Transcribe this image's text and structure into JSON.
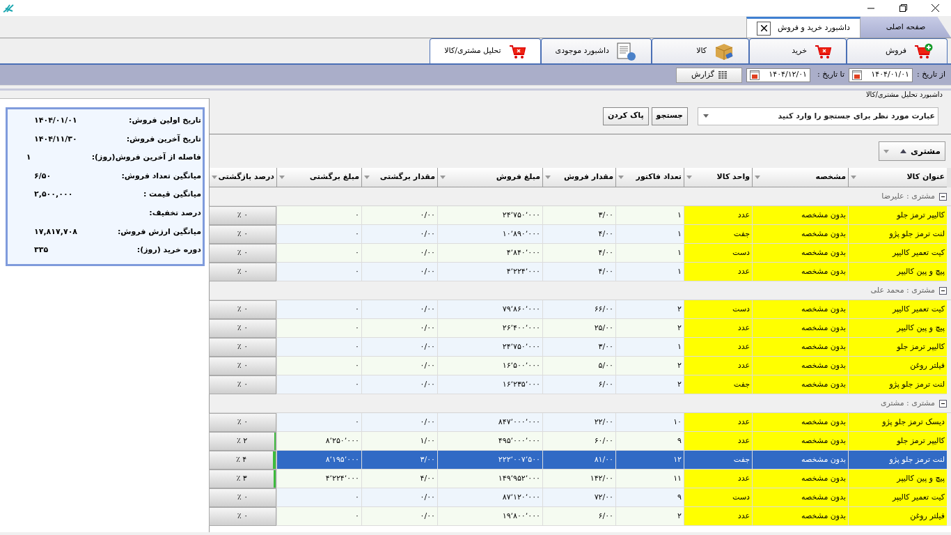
{
  "document_tabs": [
    {
      "label": "صفحه اصلی",
      "selected": false
    },
    {
      "label": "داشبورد خرید و فروش",
      "selected": true
    }
  ],
  "ribbon_tabs": [
    {
      "label": "فروش",
      "kind": "cart-plus",
      "selected": false
    },
    {
      "label": "خرید",
      "kind": "cart-x",
      "selected": false
    },
    {
      "label": "کالا",
      "kind": "box",
      "selected": false
    },
    {
      "label": "داشبورد موجودی",
      "kind": "report",
      "selected": false
    },
    {
      "label": "تحلیل مشتری/کالا",
      "kind": "cart-x",
      "selected": true
    }
  ],
  "toolbar": {
    "from_label": "از تاریخ :",
    "from_value": "۱۴۰۴/۰۱/۰۱",
    "to_label": "تا تاریخ :",
    "to_value": "۱۴۰۴/۱۲/۰۱",
    "report_button": "گزارش"
  },
  "section_title": "داشبورد تحلیل مشتری/کالا",
  "summary": [
    {
      "label": "تاریخ اولین فروش:",
      "value": "۱۴۰۴/۰۱/۰۱"
    },
    {
      "label": "تاریخ آخرین فروش:",
      "value": "۱۴۰۴/۱۱/۳۰"
    },
    {
      "label": "فاصله از آخرین فروش(روز):",
      "value": "۱"
    },
    {
      "label": "میانگین تعداد فروش:",
      "value": "۶/۵۰"
    },
    {
      "label": "میانگین قیمت :",
      "value": "۲,۵۰۰,۰۰۰"
    },
    {
      "label": "درصد تخفیف:"
    },
    {
      "label": "میانگین ارزش فروش:",
      "value": "۱۷,۸۱۷,۷۰۸"
    },
    {
      "label": "دوره خرید (روز):",
      "value": "۳۳۵"
    }
  ],
  "search": {
    "placeholder": "عبارت مورد نظر برای جستجو را وارد کنید",
    "search_button": "جستجو",
    "clear_button": "پاک کردن"
  },
  "group_by": {
    "label": "مشتری",
    "sort_ascending": true
  },
  "table": {
    "columns": [
      "عنوان کالا",
      "مشخصه",
      "واحد کالا",
      "تعداد فاکتور",
      "مقدار فروش",
      "مبلغ فروش",
      "مقدار برگشتی",
      "مبلغ برگشتی",
      "درصد بازگشتی"
    ],
    "groups": [
      {
        "label": "مشتری : علیرضا",
        "expanded": true,
        "rows": [
          {
            "cells": [
              "کالیپر ترمز جلو",
              "بدون مشخصه",
              "عدد",
              "۱",
              "۳/۰۰",
              "۲۴٬۷۵۰٬۰۰۰",
              "۰/۰۰",
              "۰"
            ],
            "percent": "٪ ۰",
            "selected": false
          },
          {
            "cells": [
              "لنت ترمز جلو پژو",
              "بدون مشخصه",
              "جفت",
              "۱",
              "۴/۰۰",
              "۱۰٬۸۹۰٬۰۰۰",
              "۰/۰۰",
              "۰"
            ],
            "percent": "٪ ۰",
            "selected": false
          },
          {
            "cells": [
              "کیت تعمیر کالیپر",
              "بدون مشخصه",
              "دست",
              "۱",
              "۴/۰۰",
              "۴٬۸۴۰٬۰۰۰",
              "۰/۰۰",
              "۰"
            ],
            "percent": "٪ ۰",
            "selected": false
          },
          {
            "cells": [
              "پیچ و پین کالیپر",
              "بدون مشخصه",
              "عدد",
              "۱",
              "۴/۰۰",
              "۴٬۲۲۴٬۰۰۰",
              "۰/۰۰",
              "۰"
            ],
            "percent": "٪ ۰",
            "selected": false
          }
        ]
      },
      {
        "label": "مشتری : محمد علی",
        "expanded": true,
        "rows": [
          {
            "cells": [
              "کیت تعمیر کالیپر",
              "بدون مشخصه",
              "دست",
              "۲",
              "۶۶/۰۰",
              "۷۹٬۸۶۰٬۰۰۰",
              "۰/۰۰",
              "۰"
            ],
            "percent": "٪ ۰",
            "selected": false
          },
          {
            "cells": [
              "پیچ و پین کالیپر",
              "بدون مشخصه",
              "عدد",
              "۲",
              "۲۵/۰۰",
              "۲۶٬۴۰۰٬۰۰۰",
              "۰/۰۰",
              "۰"
            ],
            "percent": "٪ ۰",
            "selected": false
          },
          {
            "cells": [
              "کالیپر ترمز جلو",
              "بدون مشخصه",
              "عدد",
              "۱",
              "۳/۰۰",
              "۲۴٬۷۵۰٬۰۰۰",
              "۰/۰۰",
              "۰"
            ],
            "percent": "٪ ۰",
            "selected": false
          },
          {
            "cells": [
              "فیلتر روغن",
              "بدون مشخصه",
              "عدد",
              "۲",
              "۵/۰۰",
              "۱۶٬۵۰۰٬۰۰۰",
              "۰/۰۰",
              "۰"
            ],
            "percent": "٪ ۰",
            "selected": false
          },
          {
            "cells": [
              "لنت ترمز جلو پژو",
              "بدون مشخصه",
              "جفت",
              "۲",
              "۶/۰۰",
              "۱۶٬۲۳۵٬۰۰۰",
              "۰/۰۰",
              "۰"
            ],
            "percent": "٪ ۰",
            "selected": false
          }
        ]
      },
      {
        "label": "مشتری : مشتری",
        "expanded": true,
        "rows": [
          {
            "cells": [
              "دیسک ترمز جلو پژو",
              "بدون مشخصه",
              "عدد",
              "۱۰",
              "۲۲/۰۰",
              "۸۴۷٬۰۰۰٬۰۰۰",
              "۰/۰۰",
              "۰"
            ],
            "percent": "٪ ۰",
            "selected": false
          },
          {
            "cells": [
              "کالیپر ترمز جلو",
              "بدون مشخصه",
              "عدد",
              "۹",
              "۶۰/۰۰",
              "۴۹۵٬۰۰۰٬۰۰۰",
              "۱/۰۰",
              "۸٬۲۵۰٬۰۰۰"
            ],
            "percent": "٪ ۲",
            "level": 0.02,
            "selected": false
          },
          {
            "cells": [
              "لنت ترمز جلو پژو",
              "بدون مشخصه",
              "جفت",
              "۱۲",
              "۸۱/۰۰",
              "۲۲۲٬۰۰۷٬۵۰۰",
              "۳/۰۰",
              "۸٬۱۹۵٬۰۰۰"
            ],
            "percent": "٪ ۴",
            "level": 0.04,
            "selected": true
          },
          {
            "cells": [
              "پیچ و پین کالیپر",
              "بدون مشخصه",
              "عدد",
              "۱۱",
              "۱۴۲/۰۰",
              "۱۴۹٬۹۵۲٬۰۰۰",
              "۴/۰۰",
              "۴٬۲۲۴٬۰۰۰"
            ],
            "percent": "٪ ۳",
            "level": 0.03,
            "selected": false
          },
          {
            "cells": [
              "کیت تعمیر کالیپر",
              "بدون مشخصه",
              "دست",
              "۹",
              "۷۲/۰۰",
              "۸۷٬۱۲۰٬۰۰۰",
              "۰/۰۰",
              "۰"
            ],
            "percent": "٪ ۰",
            "selected": false
          },
          {
            "cells": [
              "فیلتر روغن",
              "بدون مشخصه",
              "عدد",
              "۲",
              "۶/۰۰",
              "۱۹٬۸۰۰٬۰۰۰",
              "۰/۰۰",
              "۰"
            ],
            "percent": "٪ ۰",
            "selected": false
          }
        ]
      }
    ]
  }
}
